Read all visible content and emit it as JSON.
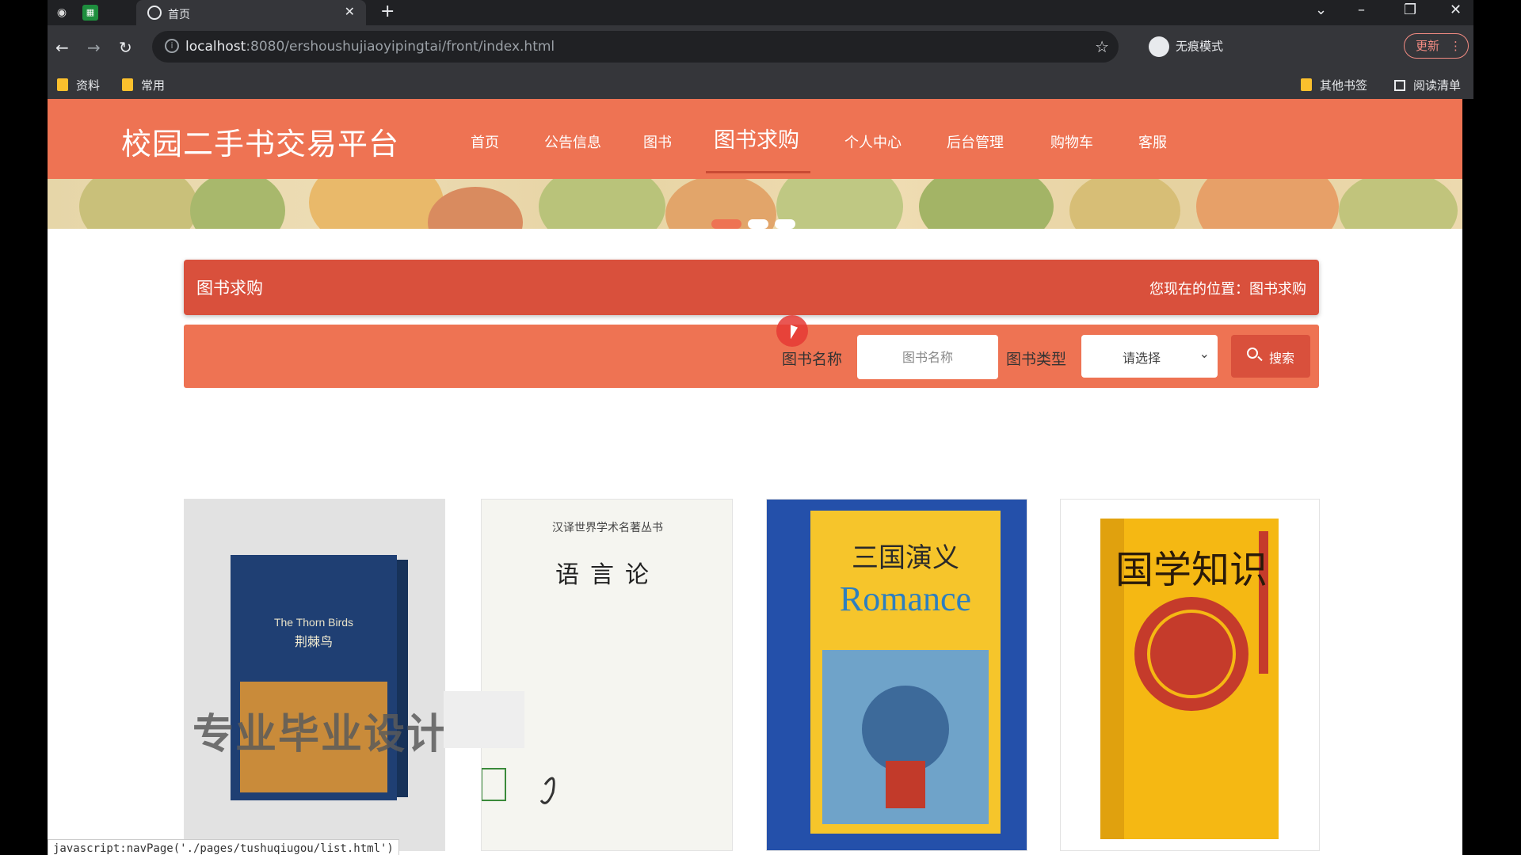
{
  "browser": {
    "tab_title": "首页",
    "url_host": "localhost",
    "url_path": ":8080/ershoushujiaoyipingtai/front/index.html",
    "incognito_label": "无痕模式",
    "update_label": "更新",
    "bookmarks": [
      "资料",
      "常用"
    ],
    "other_bookmarks": "其他书签",
    "reading_list": "阅读清单"
  },
  "site": {
    "title": "校园二手书交易平台",
    "nav": [
      "首页",
      "公告信息",
      "图书",
      "图书求购",
      "个人中心",
      "后台管理",
      "购物车",
      "客服"
    ],
    "active_nav": "图书求购"
  },
  "section": {
    "title": "图书求购",
    "breadcrumb": "您现在的位置：图书求购"
  },
  "search": {
    "name_label": "图书名称",
    "name_placeholder": "图书名称",
    "type_label": "图书类型",
    "type_selected": "请选择",
    "button_label": "搜索"
  },
  "books": [
    {
      "title_cn": "荆棘鸟",
      "title_en": "The Thorn Birds"
    },
    {
      "series": "汉译世界学术名著丛书",
      "title_cn": "语言论"
    },
    {
      "title_cn": "三国演义",
      "title_en": "Romance"
    },
    {
      "title_cn": "国学知识"
    }
  ],
  "overlay": {
    "watermark": "专业毕业设计"
  },
  "status_url": "javascript:navPage('./pages/tushuqiugou/list.html')",
  "colors": {
    "header": "#ee7353",
    "section_bar": "#d9503c"
  }
}
